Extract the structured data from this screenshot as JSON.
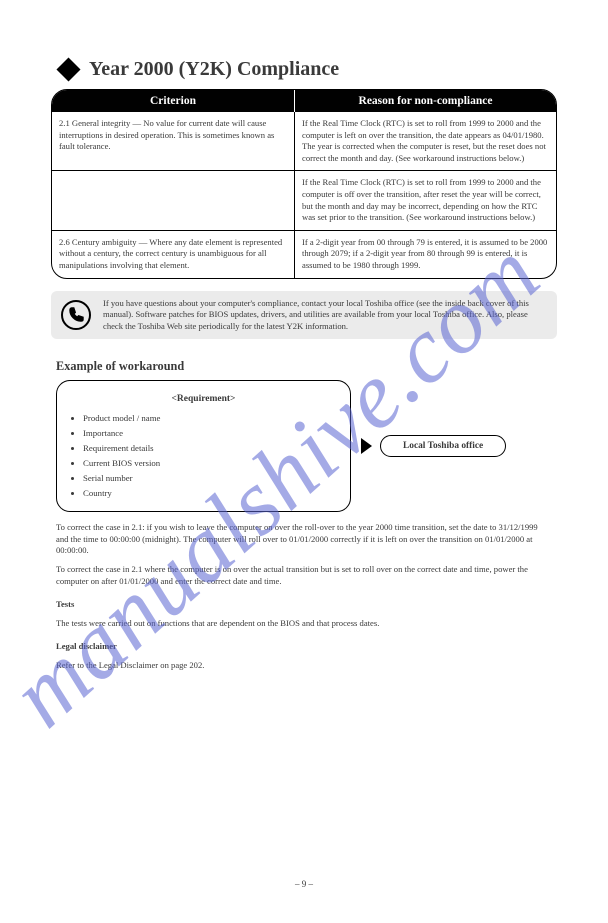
{
  "watermark": "manualshive.com",
  "header": "Year 2000 (Y2K) Compliance",
  "tableHeader": {
    "c1": "Criterion",
    "c2": "Reason for non-compliance"
  },
  "rows": [
    {
      "c1": "2.1 General integrity — No value for current date will cause interruptions in desired operation. This is sometimes known as fault tolerance.",
      "c2": "If the Real Time Clock (RTC) is set to roll from 1999 to 2000 and the computer is left on over the transition, the date appears as 04/01/1980. The year is corrected when the computer is reset, but the reset does not correct the month and day. (See workaround instructions below.)"
    },
    {
      "c1": "",
      "c2": "If the Real Time Clock (RTC) is set to roll from 1999 to 2000 and the computer is off over the transition, after reset the year will be correct, but the month and day may be incorrect, depending on how the RTC was set prior to the transition. (See workaround instructions below.)"
    },
    {
      "c1": "2.6 Century ambiguity — Where any date element is represented without a century, the correct century is unambiguous for all manipulations involving that element.",
      "c2": "If a 2-digit year from 00 through 79 is entered, it is assumed to be 2000 through 2079; if a 2-digit year from 80 through 99 is entered, it is assumed to be 1980 through 1999."
    }
  ],
  "helpText": "If you have questions about your computer's compliance, contact your local Toshiba office (see the inside back cover of this manual). Software patches for BIOS updates, drivers, and utilities are available from your local Toshiba office. Also, please check the Toshiba Web site periodically for the latest Y2K information.",
  "exampleTitle": "Example of workaround",
  "reqBox": {
    "caption": "<Requirement>",
    "items": [
      "Product model / name",
      "Importance",
      "Requirement details",
      "Current BIOS version",
      "Serial number",
      "Country"
    ]
  },
  "oval": "Local Toshiba office",
  "paras": [
    "To correct the case in 2.1: if you wish to leave the computer on over the roll-over to the year 2000 time transition, set the date to 31/12/1999 and the time to 00:00:00 (midnight). The computer will roll over to 01/01/2000 correctly if it is left on over the transition on 01/01/2000 at 00:00:00.",
    "To correct the case in 2.1 where the computer is on over the actual transition but is set to roll over on the correct date and time, power the computer on after 01/01/2000 and enter the correct date and time."
  ],
  "testsHead": "Tests",
  "testsText": "The tests were carried out on functions that are dependent on the BIOS and that process dates.",
  "legalHead": "Legal disclaimer",
  "legalText": "Refer to the Legal Disclaimer on page 202.",
  "pageNum": "– 9 –"
}
